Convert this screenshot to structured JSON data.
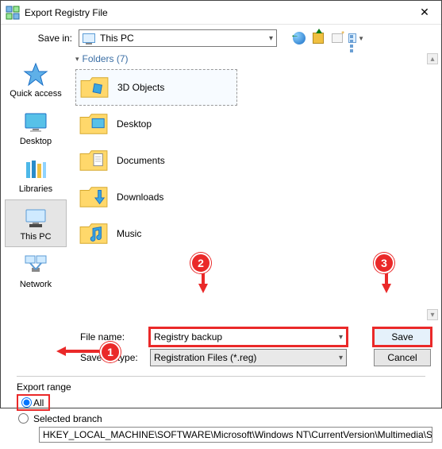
{
  "window": {
    "title": "Export Registry File"
  },
  "savein": {
    "label": "Save in:",
    "selected": "This PC"
  },
  "sidebar": {
    "items": [
      {
        "label": "Quick access"
      },
      {
        "label": "Desktop"
      },
      {
        "label": "Libraries"
      },
      {
        "label": "This PC",
        "selected": true
      },
      {
        "label": "Network"
      }
    ]
  },
  "folders": {
    "header": "Folders (7)",
    "items": [
      {
        "label": "3D Objects",
        "selected": true,
        "icon": "3d"
      },
      {
        "label": "Desktop",
        "icon": "folder"
      },
      {
        "label": "Documents",
        "icon": "documents"
      },
      {
        "label": "Downloads",
        "icon": "downloads"
      },
      {
        "label": "Music",
        "icon": "music"
      }
    ]
  },
  "fields": {
    "filename_label": "File name:",
    "filename_value": "Registry backup",
    "type_label": "Save as type:",
    "type_value": "Registration Files (*.reg)"
  },
  "buttons": {
    "save": "Save",
    "cancel": "Cancel"
  },
  "export_range": {
    "title": "Export range",
    "option_all": "All",
    "option_selected": "Selected branch",
    "path": "HKEY_LOCAL_MACHINE\\SOFTWARE\\Microsoft\\Windows NT\\CurrentVersion\\Multimedia\\SystemPro"
  },
  "annotations": {
    "b1": "1",
    "b2": "2",
    "b3": "3"
  }
}
